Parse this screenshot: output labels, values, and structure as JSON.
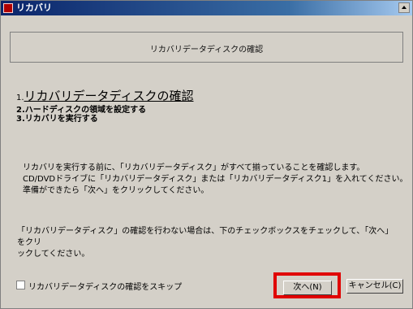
{
  "window": {
    "title": "リカバリ"
  },
  "header": {
    "title": "リカバリデータディスクの確認"
  },
  "steps": [
    {
      "num": "1.",
      "label": "リカバリデータディスクの確認"
    },
    {
      "num": "2.",
      "label": "ハードディスクの領域を設定する"
    },
    {
      "num": "3.",
      "label": "リカバリを実行する"
    }
  ],
  "description": [
    "リカバリを実行する前に、「リカバリデータディスク」がすべて揃っていることを確認します。",
    "CD/DVDドライブに「リカバリデータディスク」または「リカバリデータディスク1」を入れてください。",
    "準備ができたら「次へ」をクリックしてください。"
  ],
  "note": [
    "「リカバリデータディスク」の確認を行わない場合は、下のチェックボックスをチェックして、「次へ」をクリ",
    "ックしてください。"
  ],
  "skip_checkbox": {
    "label": "リカバリデータディスクの確認をスキップ",
    "checked": false
  },
  "buttons": {
    "next": "次へ(N)",
    "cancel": "キャンセル(C)"
  },
  "colors": {
    "highlight": "#e00000",
    "titlebar": "#0a246a"
  }
}
